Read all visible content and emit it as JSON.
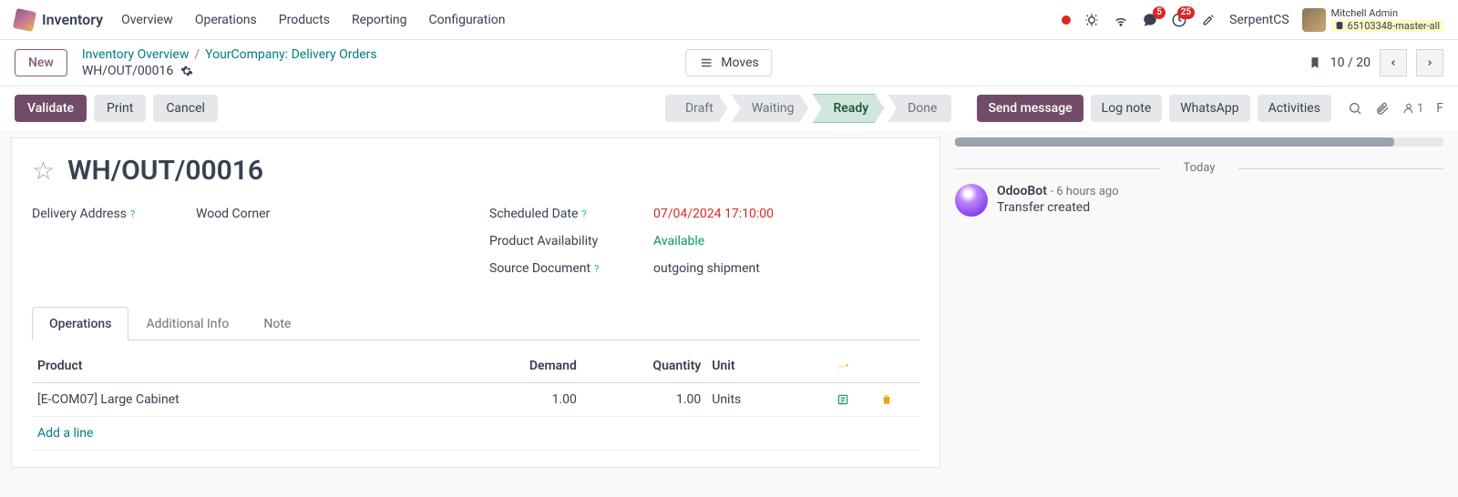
{
  "nav": {
    "app": "Inventory",
    "items": [
      "Overview",
      "Operations",
      "Products",
      "Reporting",
      "Configuration"
    ],
    "company": "SerpentCS",
    "user_name": "Mitchell Admin",
    "db_name": "65103348-master-all",
    "chat_badge": "5",
    "clock_badge": "25"
  },
  "breadcrumb": {
    "new_btn": "New",
    "links": [
      "Inventory Overview",
      "YourCompany: Delivery Orders"
    ],
    "current": "WH/OUT/00016",
    "moves_label": "Moves",
    "pager": "10 / 20"
  },
  "actions": {
    "validate": "Validate",
    "print": "Print",
    "cancel": "Cancel",
    "statuses": [
      "Draft",
      "Waiting",
      "Ready",
      "Done"
    ],
    "active_status": "Ready"
  },
  "chatter_tabs": {
    "send": "Send message",
    "log": "Log note",
    "whatsapp": "WhatsApp",
    "activities": "Activities",
    "followers": "1",
    "overflow": "F"
  },
  "record": {
    "title": "WH/OUT/00016",
    "fields_left": {
      "delivery_address_label": "Delivery Address",
      "delivery_address_value": "Wood Corner"
    },
    "fields_right": {
      "scheduled_date_label": "Scheduled Date",
      "scheduled_date_value": "07/04/2024 17:10:00",
      "availability_label": "Product Availability",
      "availability_value": "Available",
      "source_doc_label": "Source Document",
      "source_doc_value": "outgoing shipment"
    }
  },
  "notebook": {
    "tabs": [
      "Operations",
      "Additional Info",
      "Note"
    ],
    "columns": {
      "product": "Product",
      "demand": "Demand",
      "quantity": "Quantity",
      "unit": "Unit"
    },
    "rows": [
      {
        "product": "[E-COM07] Large Cabinet",
        "demand": "1.00",
        "quantity": "1.00",
        "unit": "Units"
      }
    ],
    "add_line": "Add a line"
  },
  "chatter": {
    "today": "Today",
    "author": "OdooBot",
    "time": "- 6 hours ago",
    "text": "Transfer created"
  }
}
